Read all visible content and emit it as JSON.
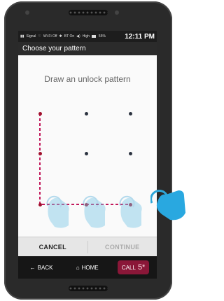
{
  "status_bar": {
    "signal": "Signal",
    "wifi": "Wi-Fi Off",
    "bluetooth": "BT On",
    "volume": "High",
    "battery": "55%",
    "time": "12:11 PM"
  },
  "app_bar": {
    "title": "Choose your pattern"
  },
  "instruction": "Draw an unlock pattern",
  "pattern": {
    "grid": "3x3",
    "selected_sequence": [
      1,
      4,
      7,
      8,
      9
    ],
    "line_color": "#c2185b",
    "dot_color": "#2c3340"
  },
  "actions": {
    "cancel": "CANCEL",
    "continue": "CONTINUE"
  },
  "nav": {
    "back": "BACK",
    "home": "HOME",
    "call": "CALL",
    "call_number": "5*"
  },
  "colors": {
    "accent": "#8a1738",
    "hint": "#7ec8e8"
  }
}
